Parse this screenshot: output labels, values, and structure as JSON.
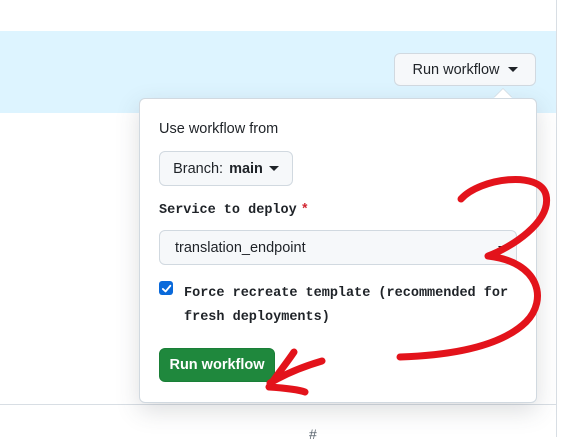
{
  "header": {
    "run_workflow_label": "Run workflow"
  },
  "popover": {
    "use_workflow_from_label": "Use workflow from",
    "branch": {
      "prefix": "Branch:",
      "value": "main"
    },
    "service_label": "Service to deploy",
    "required_marker": "*",
    "service_selected": "translation_endpoint",
    "force_recreate": {
      "checked": true,
      "label": "Force recreate template (recommended for fresh deployments)"
    },
    "submit_label": "Run workflow"
  },
  "annotation": {
    "number": "3"
  },
  "colors": {
    "banner": "#ddf4ff",
    "primary_green": "#1f883d",
    "checkbox_blue": "#0969da",
    "required_red": "#d1242f",
    "annotation_red": "#e3131b"
  }
}
